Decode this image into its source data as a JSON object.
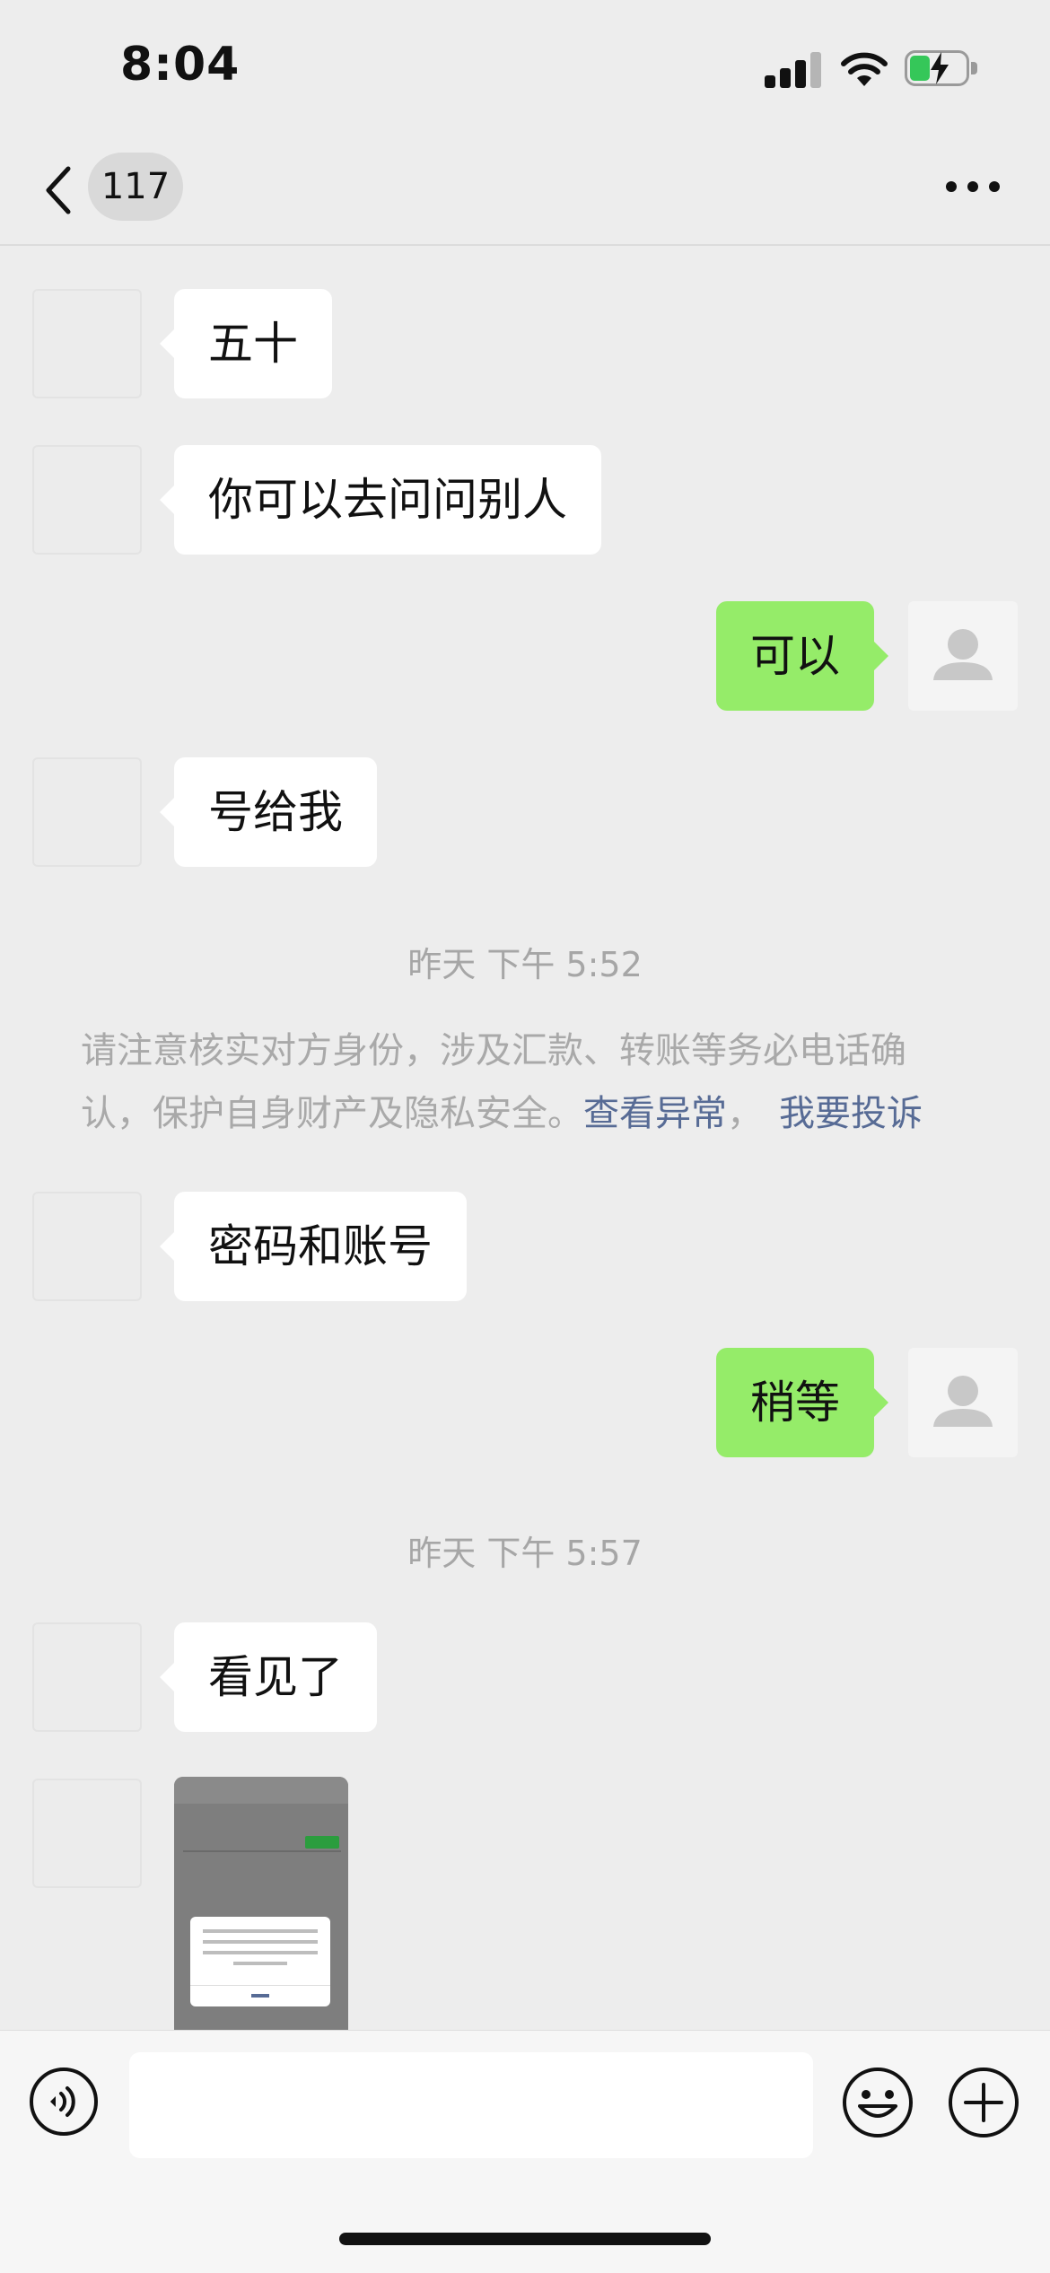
{
  "status_bar": {
    "time": "8:04"
  },
  "nav": {
    "unread_count": "117"
  },
  "messages": [
    {
      "side": "left",
      "text": "五十"
    },
    {
      "side": "left",
      "text": "你可以去问问别人"
    },
    {
      "side": "right",
      "text": "可以"
    },
    {
      "side": "left",
      "text": "号给我"
    },
    {
      "timestamp": "昨天 下午 5:52"
    },
    {
      "notice": "请注意核实对方身份，涉及汇款、转账等务必电话确认，保护自身财产及隐私安全。",
      "link1": "查看异常",
      "sep": "，",
      "link2": "我要投诉"
    },
    {
      "side": "left",
      "text": "密码和账号"
    },
    {
      "side": "right",
      "text": "稍等"
    },
    {
      "timestamp": "昨天 下午 5:57"
    },
    {
      "side": "left",
      "text": "看见了"
    },
    {
      "side": "left",
      "type": "image"
    }
  ],
  "input_bar": {
    "voice_icon": "voice-icon",
    "emoji_icon": "emoji-icon",
    "plus_icon": "plus-icon"
  },
  "colors": {
    "background": "#ededed",
    "my_bubble": "#95ec69",
    "their_bubble": "#ffffff",
    "link": "#576b95"
  }
}
